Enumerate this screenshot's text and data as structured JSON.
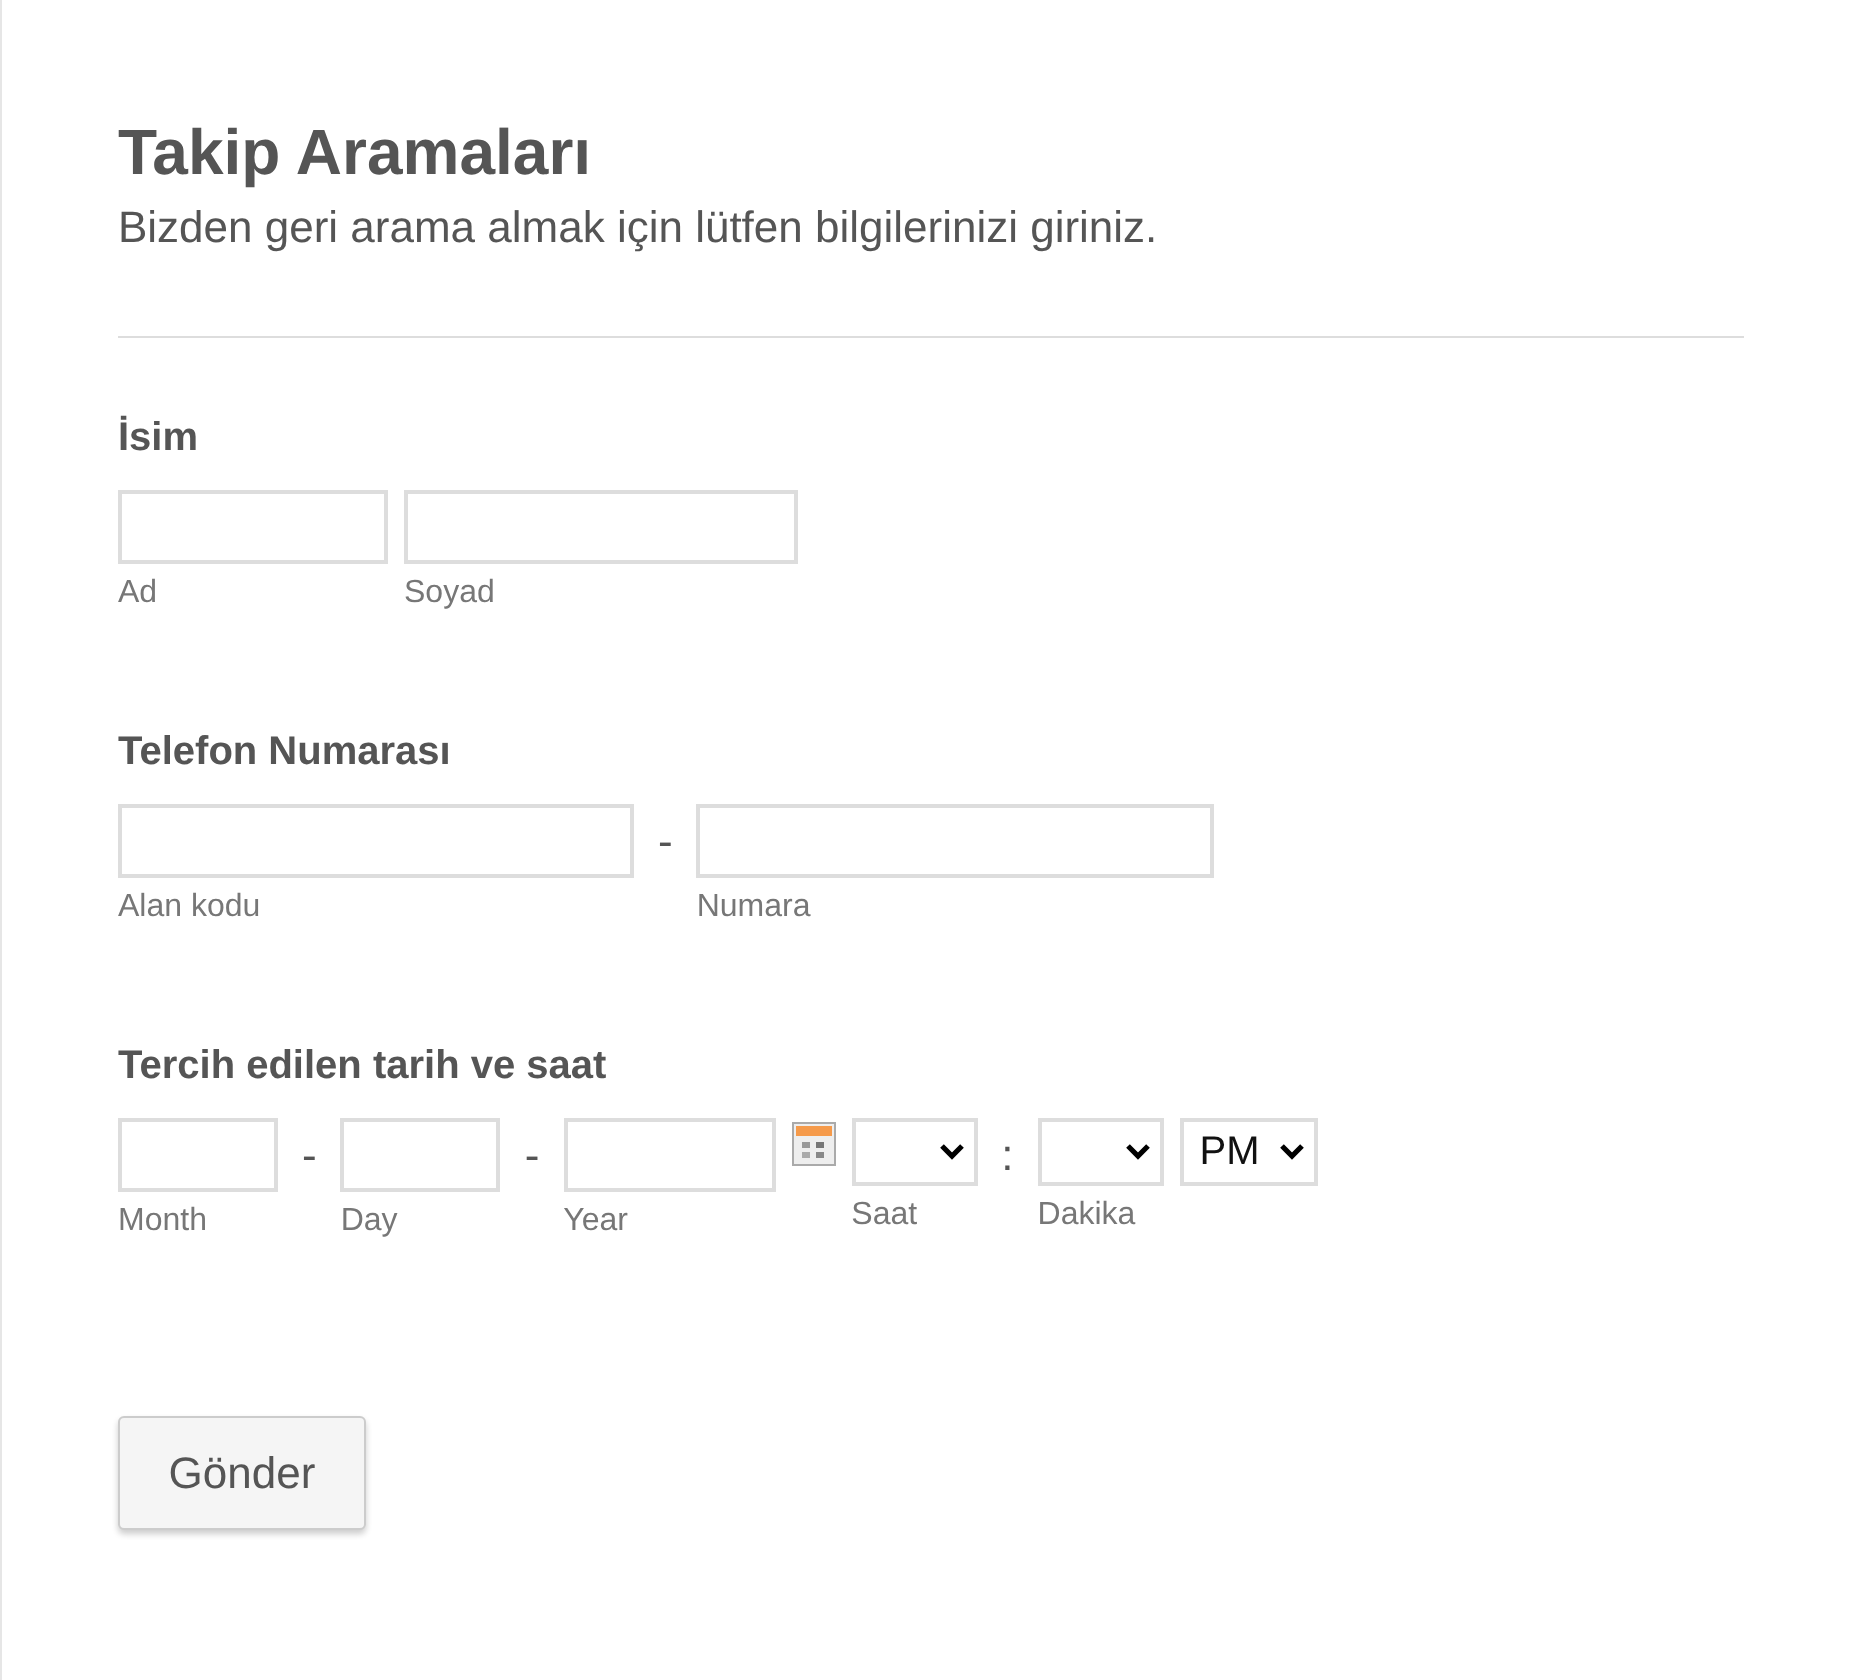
{
  "header": {
    "title": "Takip Aramaları",
    "subtitle": "Bizden geri arama almak için lütfen bilgilerinizi giriniz."
  },
  "sections": [
    {
      "label": "İsim",
      "items": [
        {
          "kind": "text",
          "sublabel": "Ad"
        },
        {
          "kind": "text",
          "sublabel": "Soyad"
        }
      ]
    },
    {
      "label": "Telefon Numarası",
      "items": [
        {
          "kind": "text",
          "sublabel": "Alan kodu"
        },
        {
          "kind": "separator",
          "text": "-"
        },
        {
          "kind": "text",
          "sublabel": "Numara"
        }
      ]
    },
    {
      "label": "Tercih edilen tarih ve saat",
      "items": [
        {
          "kind": "text",
          "sublabel": "Month"
        },
        {
          "kind": "separator",
          "text": "-"
        },
        {
          "kind": "text",
          "sublabel": "Day"
        },
        {
          "kind": "separator",
          "text": "-"
        },
        {
          "kind": "text",
          "sublabel": "Year"
        },
        {
          "kind": "calendar"
        },
        {
          "kind": "select",
          "sublabel": "Saat"
        },
        {
          "kind": "separator",
          "text": ":"
        },
        {
          "kind": "select",
          "sublabel": "Dakika"
        },
        {
          "kind": "select",
          "value": "PM"
        }
      ]
    }
  ],
  "submit": "Gönder"
}
